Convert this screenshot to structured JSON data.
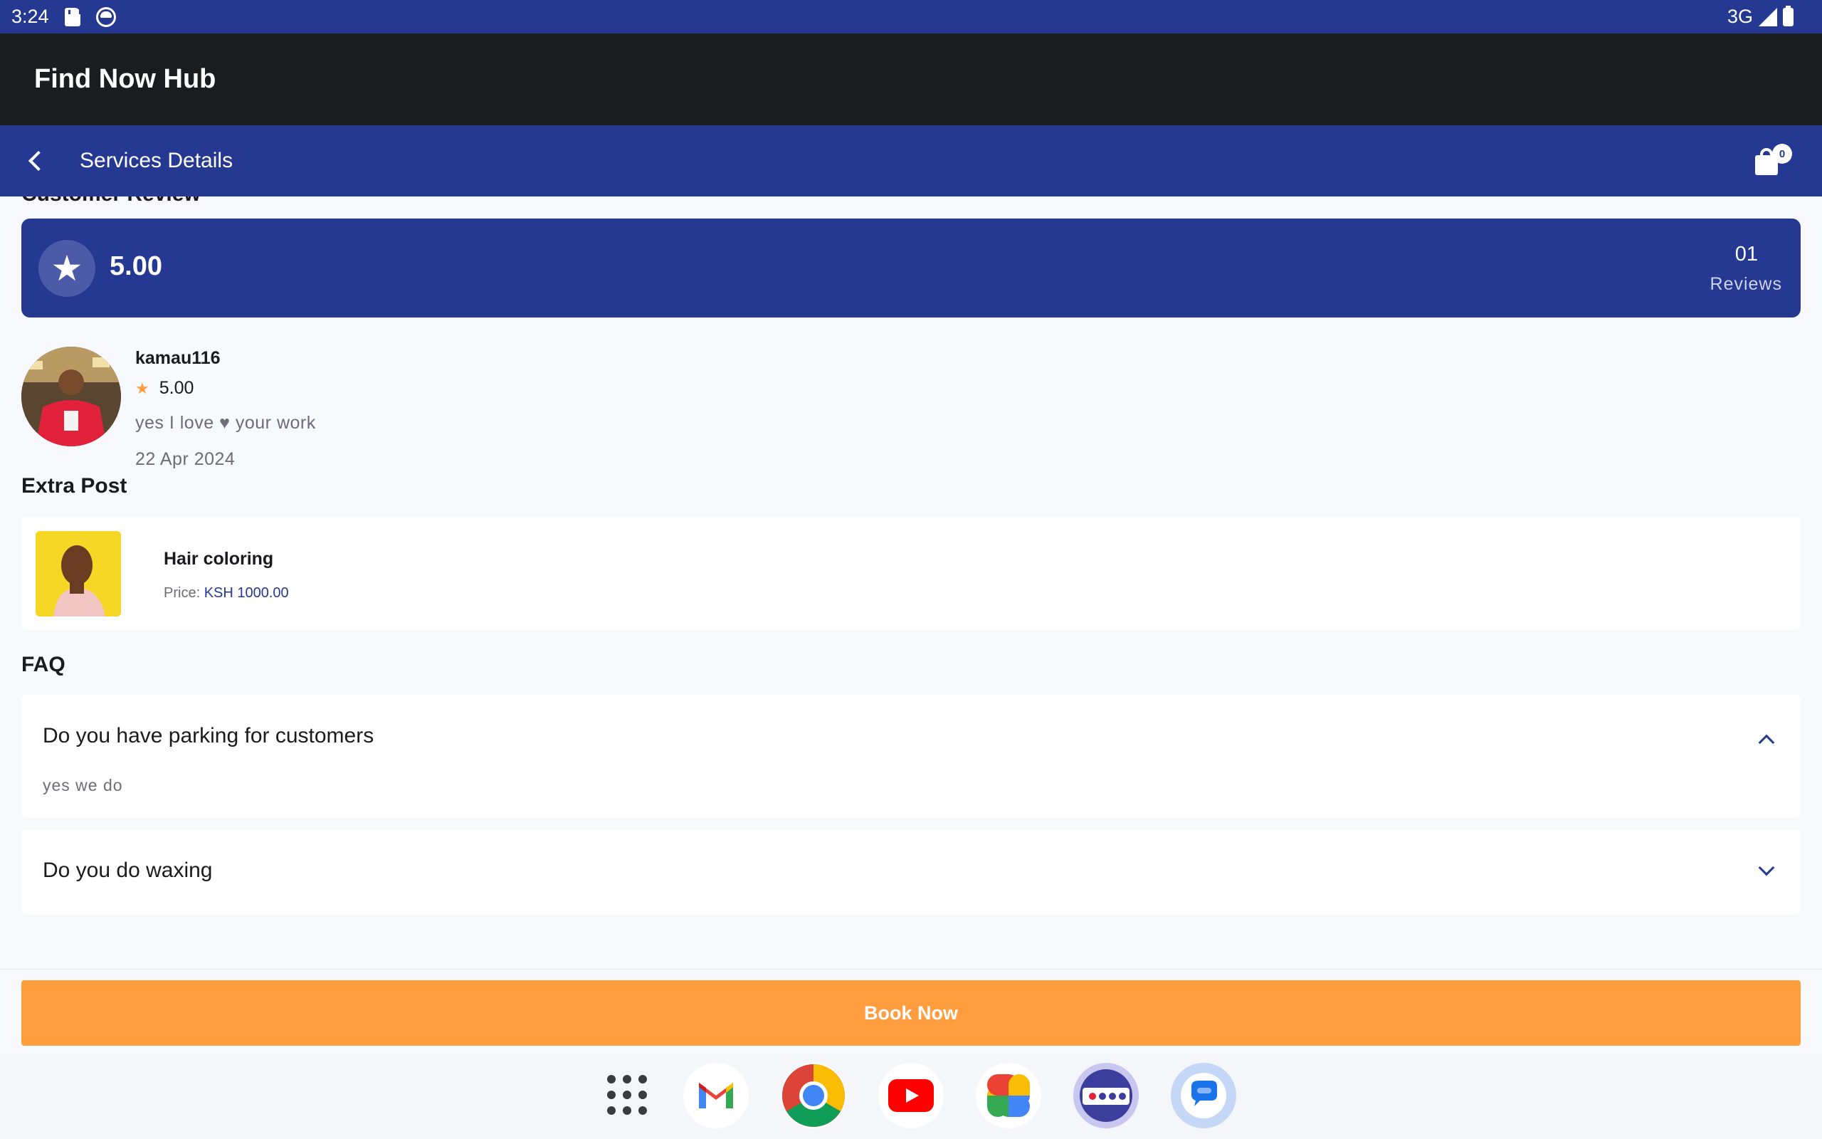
{
  "status_bar": {
    "time": "3:24",
    "network": "3G"
  },
  "app": {
    "title": "Find Now Hub"
  },
  "sub_bar": {
    "title": "Services Details",
    "cart_count": "0"
  },
  "cut_heading": "Customer Review",
  "rating_summary": {
    "value": "5.00",
    "count": "01",
    "count_label": "Reviews"
  },
  "review": {
    "name": "kamau116",
    "rating": "5.00",
    "text_before": "yes I love",
    "text_after": "your work",
    "date": "22 Apr 2024"
  },
  "extra_post": {
    "heading": "Extra Post",
    "name": "Hair coloring",
    "price_label": "Price:",
    "price_value": "KSH 1000.00"
  },
  "faq": {
    "heading": "FAQ",
    "items": [
      {
        "question": "Do you have parking for customers",
        "answer": "yes we do",
        "expanded": true
      },
      {
        "question": "Do you do waxing",
        "answer": "",
        "expanded": false
      }
    ]
  },
  "book_button": "Book Now",
  "colors": {
    "primary": "#253892",
    "accent": "#ff9d3f",
    "app_bar": "#1b1c20"
  },
  "dock": [
    "apps-grid-icon",
    "gmail-icon",
    "chrome-icon",
    "youtube-icon",
    "photos-icon",
    "findnow-app-icon",
    "messages-icon"
  ]
}
